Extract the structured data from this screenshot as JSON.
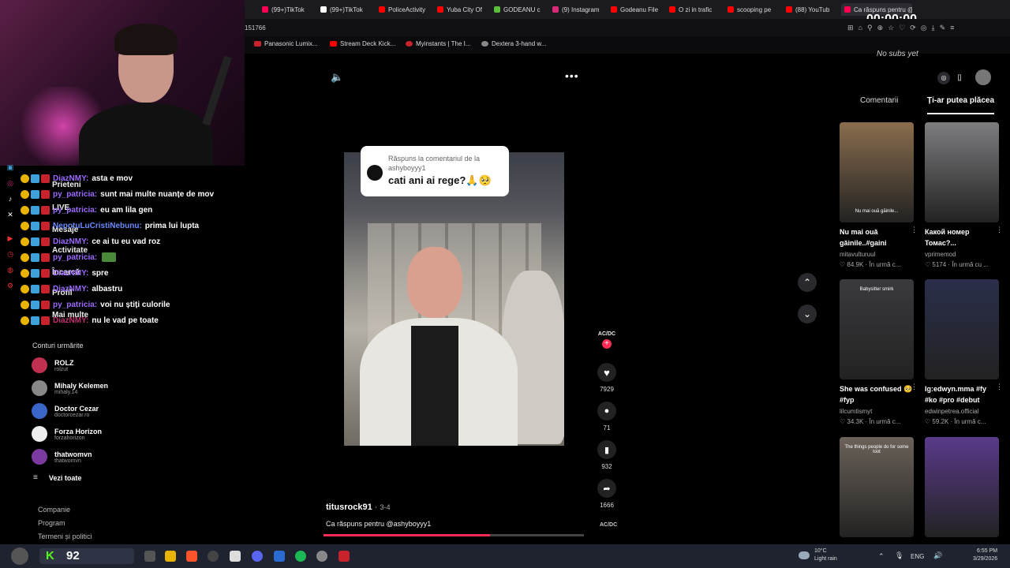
{
  "browser": {
    "tabs": [
      {
        "label": "(99+)TikTok",
        "color": "#ff0050"
      },
      {
        "label": "(99+)TikTok",
        "color": "#ffffff"
      },
      {
        "label": "PoliceActivity",
        "color": "#ff0000"
      },
      {
        "label": "Yuba City Of",
        "color": "#ff0000"
      },
      {
        "label": "GODEANU c",
        "color": "#5bbf3a"
      },
      {
        "label": "(9) Instagram",
        "color": "#d62976"
      },
      {
        "label": "Godeanu File",
        "color": "#ff0000"
      },
      {
        "label": "O zi in trafic",
        "color": "#ff0000"
      },
      {
        "label": "scooping pe",
        "color": "#ff0000"
      },
      {
        "label": "(88) YouTub",
        "color": "#ff0000"
      },
      {
        "label": "Ca răspuns pentru @...",
        "color": "#ff0050"
      }
    ],
    "address_fragment": "151766",
    "bookmarks": [
      {
        "label": "Panasonic Lumix...",
        "color": "#c8232c"
      },
      {
        "label": "Stream Deck Kick...",
        "color": "#ff0000"
      },
      {
        "label": "Myinstants | The I...",
        "color": "#c8232c"
      },
      {
        "label": "Dextera 3-hand w...",
        "color": "#888888"
      }
    ],
    "timer": "00:00:00",
    "subs_text": "No subs yet"
  },
  "chat": {
    "messages": [
      {
        "user": "DiazNMY:",
        "user_color": "#9b6bff",
        "text": "asta e mov"
      },
      {
        "user": "py_patricia:",
        "user_color": "#9b6bff",
        "text": "sunt mai multe nuanțe de mov"
      },
      {
        "user": "py_patricia:",
        "user_color": "#9b6bff",
        "text": "eu am lila gen"
      },
      {
        "user": "NepotuLuCristiNebunu:",
        "user_color": "#6b8bff",
        "text": "prima lui lupta"
      },
      {
        "user": "DiazNMY:",
        "user_color": "#9b6bff",
        "text": "ce ai tu eu vad roz"
      },
      {
        "user": "py_patricia:",
        "user_color": "#9b6bff",
        "text": ""
      },
      {
        "user": "DiazNMY:",
        "user_color": "#9b6bff",
        "text": "spre"
      },
      {
        "user": "DiazNMY:",
        "user_color": "#9b6bff",
        "text": "albastru"
      },
      {
        "user": "py_patricia:",
        "user_color": "#9b6bff",
        "text": "voi nu știți culorile"
      },
      {
        "user": "DiazNMY:",
        "user_color": "#c03070",
        "text": "nu le vad pe toate"
      }
    ],
    "ghost_nav": [
      "Prieteni",
      "LIVE",
      "Mesaje",
      "Activitate",
      "Încarcă",
      "Profil",
      "Mai multe"
    ]
  },
  "sidebar": {
    "follows_heading": "Conturi urmărite",
    "follows": [
      {
        "name": "ROLZ",
        "handle": "rolzut",
        "color": "#c03050"
      },
      {
        "name": "Mihaly Kelemen",
        "handle": "mihaly.14",
        "color": "#888888"
      },
      {
        "name": "Doctor Cezar",
        "handle": "doctorcezar.ro",
        "color": "#3a66c8"
      },
      {
        "name": "Forza Horizon",
        "handle": "forzahorizon",
        "color": "#eeeeee"
      },
      {
        "name": "thatwomvn",
        "handle": "thatwomvn",
        "color": "#7a3aa0"
      }
    ],
    "see_all": "Vezi toate",
    "footer_links": [
      "Companie",
      "Program",
      "Termeni și politici"
    ]
  },
  "video": {
    "comment_reply_label": "Răspuns la comentariul de la ashyboyyy1",
    "comment_text": "cati ani ai rege?🙏🥺",
    "author": "titusrock91",
    "date": "3-4",
    "caption": "Ca răspuns pentru @ashyboyyy1",
    "music_label": "AC/DC",
    "likes": "7929",
    "comments": "71",
    "saves": "932",
    "shares": "1666",
    "progress": 0.64
  },
  "recommendations": {
    "tabs": [
      "Comentarii",
      "Ți-ar putea plăcea"
    ],
    "items": [
      {
        "title": "Nu mai ouă găinile..#gaini",
        "author": "mitavulturuul",
        "likes": "84.9K",
        "time": "În urmă c...",
        "thumb_color": "#8a6d4d",
        "overlay": "Nu mai ouă găinile..."
      },
      {
        "title": "Какой номер Томас?...",
        "author": "vprimemod",
        "likes": "5174",
        "time": "În urmă cu ...",
        "thumb_color": "#7d7d80",
        "overlay": ""
      },
      {
        "title": "She was confused 🥺 #fyp",
        "author": "lilcumtismyt",
        "likes": "34.3K",
        "time": "În urmă c...",
        "thumb_color": "#3a3a3e",
        "overlay": "Babysitter smirk"
      },
      {
        "title": "Ig:edwyn.mma #fy #ko #pro #debut",
        "author": "edwinpetrea.official",
        "likes": "59.2K",
        "time": "În urmă c...",
        "thumb_color": "#2a2e4a",
        "overlay": ""
      },
      {
        "title": "",
        "author": "",
        "likes": "",
        "time": "",
        "thumb_color": "#6b6259",
        "overlay": "The things people do for some loot"
      },
      {
        "title": "",
        "author": "",
        "likes": "",
        "time": "",
        "thumb_color": "#5a3a8a",
        "overlay": ""
      }
    ]
  },
  "taskbar": {
    "stream_counter": "92",
    "weather_temp": "10°C",
    "weather_desc": "Light rain",
    "lang": "ENG",
    "time": "6:55 PM",
    "date": "3/29/2026"
  }
}
